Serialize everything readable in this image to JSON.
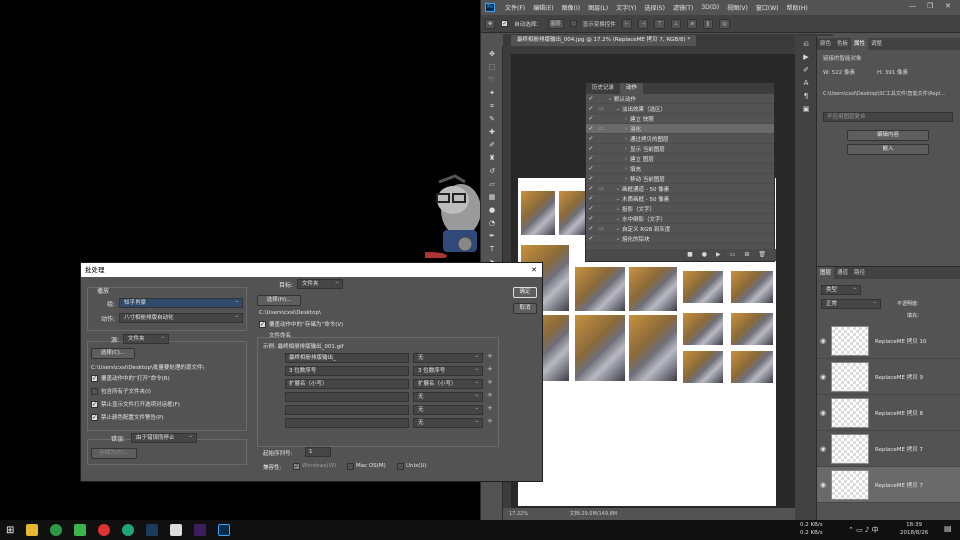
{
  "ps": {
    "logo": "Ps",
    "menu": [
      "文件(F)",
      "编辑(E)",
      "图像(I)",
      "图层(L)",
      "文字(Y)",
      "选择(S)",
      "滤镜(T)",
      "3D(D)",
      "视图(V)",
      "窗口(W)",
      "帮助(H)"
    ],
    "options": {
      "auto_select": "自动选择：",
      "show_transform": "显示变换控件"
    },
    "doc_tab": "最终相册排版输出_004.jpg @ 17.2% (ReplaceME 拷贝 7, RGB/8) *",
    "zoom": "17.22%",
    "doc_size": "文档:29.0M/149.8M",
    "tools": [
      "move-icon",
      "marquee-icon",
      "lasso-icon",
      "wand-icon",
      "crop-icon",
      "eyedropper-icon",
      "heal-icon",
      "brush-icon",
      "stamp-icon",
      "history-brush-icon",
      "eraser-icon",
      "gradient-icon",
      "blur-icon",
      "dodge-icon",
      "pen-icon",
      "type-icon",
      "path-select-icon",
      "shape-icon",
      "hand-icon",
      "zoom-icon"
    ]
  },
  "properties": {
    "tabs": [
      "颜色",
      "色板",
      "属性",
      "调整"
    ],
    "title": "链接的智能对象",
    "w": "W: 522 像素",
    "h": "H: 391 像素",
    "path": "C:\\Users\\cxsl\\Desktop\\SC工具文件\\智能文件\\Repl...",
    "placeholder": "不应用图层复合",
    "btn1": "编辑内容",
    "btn2": "嵌入"
  },
  "layers": {
    "tabs": [
      "图层",
      "通道",
      "路径"
    ],
    "kind": "类型",
    "blend": "正常",
    "opacity": "不透明度:",
    "fill": "填充:",
    "items": [
      "ReplaceME 拷贝 10",
      "ReplaceME 拷贝 9",
      "ReplaceME 拷贝 8",
      "ReplaceME 拷贝 7",
      "ReplaceME 拷贝 7"
    ]
  },
  "actions": {
    "tabs": [
      "历史记录",
      "动作"
    ],
    "rows": [
      {
        "label": "默认动作",
        "level": 0
      },
      {
        "label": "淡出效果（选区）",
        "level": 1
      },
      {
        "label": "建立 快照",
        "level": 2
      },
      {
        "label": "羽化",
        "level": 2
      },
      {
        "label": "通过拷贝的图层",
        "level": 2
      },
      {
        "label": "显示 当前图层",
        "level": 2
      },
      {
        "label": "建立 图层",
        "level": 2
      },
      {
        "label": "填充",
        "level": 2
      },
      {
        "label": "移动 当前图层",
        "level": 2
      },
      {
        "label": "画框通道 - 50 像素",
        "level": 1
      },
      {
        "label": "木质画框 - 50 像素",
        "level": 1
      },
      {
        "label": "投影（文字）",
        "level": 1
      },
      {
        "label": "水中倒影（文字）",
        "level": 1
      },
      {
        "label": "自定义 RGB 到灰度",
        "level": 1
      },
      {
        "label": "熔化的铅块",
        "level": 1
      }
    ]
  },
  "dialog": {
    "title": "批处理",
    "play_label": "播放",
    "group_label": "组:",
    "group_value": "知乎肖豪",
    "action_label": "动作:",
    "action_value": "八寸相册排版自动化",
    "source_label": "源:",
    "source_value": "文件夹",
    "choose_btn": "选择(C)...",
    "source_path": "C:\\Users\\cxsl\\Desktop\\批量要处理的源文件\\",
    "cb_override_open": "覆盖动作中的“打开”命令(R)",
    "cb_include_sub": "包含所有子文件夹(I)",
    "cb_suppress_open": "禁止显示文件打开选项对话框(F)",
    "cb_suppress_color": "禁止颜色配置文件警告(P)",
    "error_label": "错误:",
    "error_value": "由于错误而停止",
    "save_as_btn": "存储为(E)...",
    "dest_label": "目标:",
    "dest_value": "文件夹",
    "dest_choose_btn": "选择(H)...",
    "dest_path": "C:\\Users\\cxsl\\Desktop\\",
    "cb_override_save": "覆盖动作中的“存储为”命令(V)",
    "naming_label": "文件命名",
    "example": "示例: 最终相册排版输出_001.gif",
    "naming_rows": [
      {
        "text": "最终相册排版输出_",
        "select": "无"
      },
      {
        "text": "3 位数序号",
        "select": "3 位数序号"
      },
      {
        "text": "扩展名（小写）",
        "select": "扩展名（小写）"
      },
      {
        "text": "",
        "select": "无"
      },
      {
        "text": "",
        "select": "无"
      },
      {
        "text": "",
        "select": "无"
      }
    ],
    "start_serial_label": "起始序列号:",
    "start_serial": "1",
    "compat_label": "兼容性:",
    "compat_windows": "Windows(W)",
    "compat_mac": "Mac OS(M)",
    "compat_unix": "Unix(U)",
    "ok": "确定",
    "cancel": "取消"
  },
  "taskbar": {
    "net_up": "0.2 KB/s",
    "net_down": "0.2 KB/s",
    "time": "18:39",
    "date": "2018/8/26"
  }
}
